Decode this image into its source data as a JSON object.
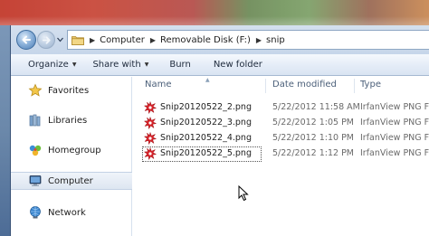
{
  "window": {
    "colors": {
      "address_bg": "#c9d8ea",
      "toolbar_bg": "#e4ecf7",
      "selection": "#dde6f1"
    }
  },
  "address": {
    "crumbs": [
      "Computer",
      "Removable Disk (F:)",
      "snip"
    ]
  },
  "toolbar": {
    "organize_label": "Organize",
    "share_label": "Share with",
    "burn_label": "Burn",
    "new_folder_label": "New folder"
  },
  "nav": {
    "items": [
      {
        "label": "Favorites",
        "icon": "star-icon"
      },
      {
        "label": "Libraries",
        "icon": "libraries-icon"
      },
      {
        "label": "Homegroup",
        "icon": "homegroup-icon"
      },
      {
        "label": "Computer",
        "icon": "computer-icon",
        "selected": true
      },
      {
        "label": "Network",
        "icon": "network-icon"
      }
    ]
  },
  "files": {
    "columns": {
      "name": "Name",
      "date": "Date modified",
      "type": "Type"
    },
    "rows": [
      {
        "name": "Snip20120522_2.png",
        "date": "5/22/2012 11:58 AM",
        "type": "IrfanView PNG File",
        "icon": "irfanview-png-icon"
      },
      {
        "name": "Snip20120522_3.png",
        "date": "5/22/2012 1:05 PM",
        "type": "IrfanView PNG File",
        "icon": "irfanview-png-icon"
      },
      {
        "name": "Snip20120522_4.png",
        "date": "5/22/2012 1:10 PM",
        "type": "IrfanView PNG File",
        "icon": "irfanview-png-icon"
      },
      {
        "name": "Snip20120522_5.png",
        "date": "5/22/2012 1:12 PM",
        "type": "IrfanView PNG File",
        "icon": "irfanview-png-icon",
        "focused": true
      }
    ]
  }
}
